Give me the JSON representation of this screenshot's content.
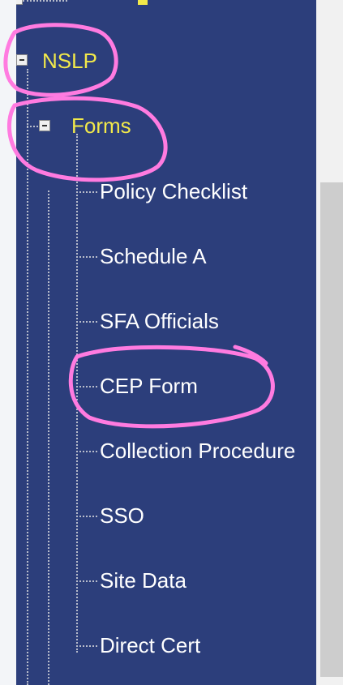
{
  "tree": {
    "top_partial_label": "",
    "nslp": {
      "label": "NSLP"
    },
    "forms": {
      "label": "Forms"
    },
    "items": [
      {
        "label": "Policy Checklist"
      },
      {
        "label": "Schedule A"
      },
      {
        "label": "SFA Officials"
      },
      {
        "label": "CEP Form"
      },
      {
        "label": "Collection Procedure"
      },
      {
        "label": "SSO"
      },
      {
        "label": "Site Data"
      },
      {
        "label": "Direct Cert"
      }
    ]
  },
  "annotation": {
    "color": "#ff7be0"
  },
  "colors": {
    "nav_bg": "#2c3e7b",
    "highlight_text": "#f2e94a",
    "item_text": "#ffffff"
  }
}
